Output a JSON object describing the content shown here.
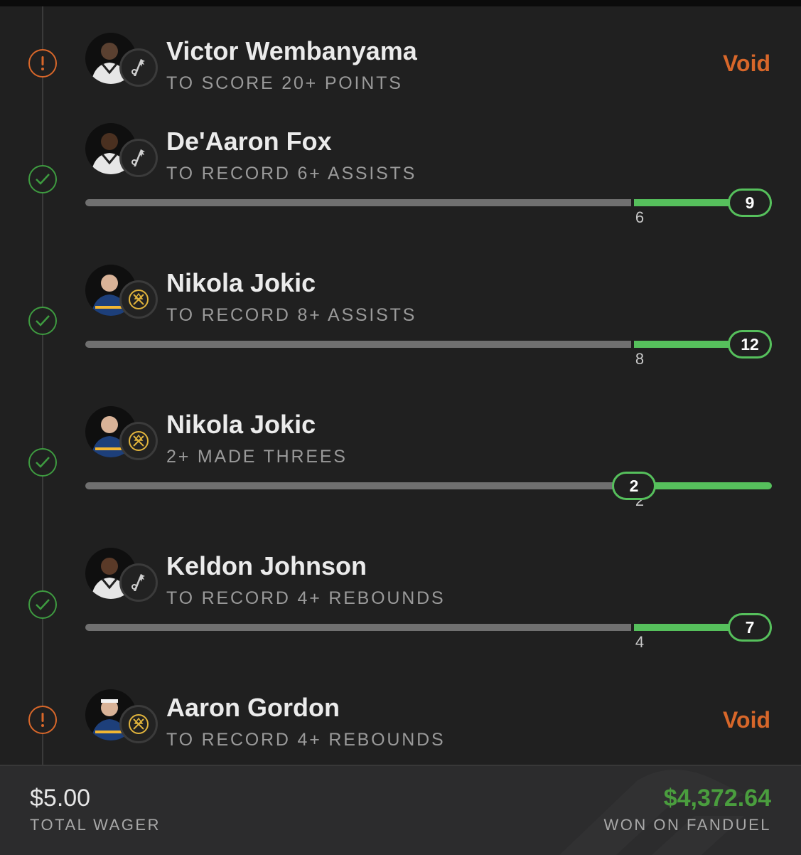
{
  "legs": [
    {
      "player": "Victor Wembanyama",
      "market": "TO SCORE 20+ POINTS",
      "status": "void",
      "result_label": "Void",
      "team_icon": "spurs-logo-icon"
    },
    {
      "player": "De'Aaron Fox",
      "market": "TO RECORD 6+ ASSISTS",
      "status": "won",
      "team_icon": "spurs-logo-icon",
      "progress": {
        "threshold": "6",
        "actual": "9"
      }
    },
    {
      "player": "Nikola Jokic",
      "market": "TO RECORD 8+ ASSISTS",
      "status": "won",
      "team_icon": "nuggets-logo-icon",
      "progress": {
        "threshold": "8",
        "actual": "12"
      }
    },
    {
      "player": "Nikola Jokic",
      "market": "2+ MADE THREES",
      "status": "won",
      "team_icon": "nuggets-logo-icon",
      "progress": {
        "threshold": "2",
        "actual": "2"
      }
    },
    {
      "player": "Keldon Johnson",
      "market": "TO RECORD 4+ REBOUNDS",
      "status": "won",
      "team_icon": "spurs-logo-icon",
      "progress": {
        "threshold": "4",
        "actual": "7"
      }
    },
    {
      "player": "Aaron Gordon",
      "market": "TO RECORD 4+ REBOUNDS",
      "status": "void",
      "result_label": "Void",
      "team_icon": "nuggets-logo-icon"
    }
  ],
  "footer": {
    "wager_amount": "$5.00",
    "wager_label": "TOTAL WAGER",
    "won_amount": "$4,372.64",
    "won_label": "WON ON FANDUEL"
  },
  "colors": {
    "background": "#202020",
    "void": "#d8672a",
    "won": "#3e9b40",
    "progress_green": "#56c05c",
    "progress_gray": "#707070",
    "payout_green": "#4a9d3e"
  }
}
